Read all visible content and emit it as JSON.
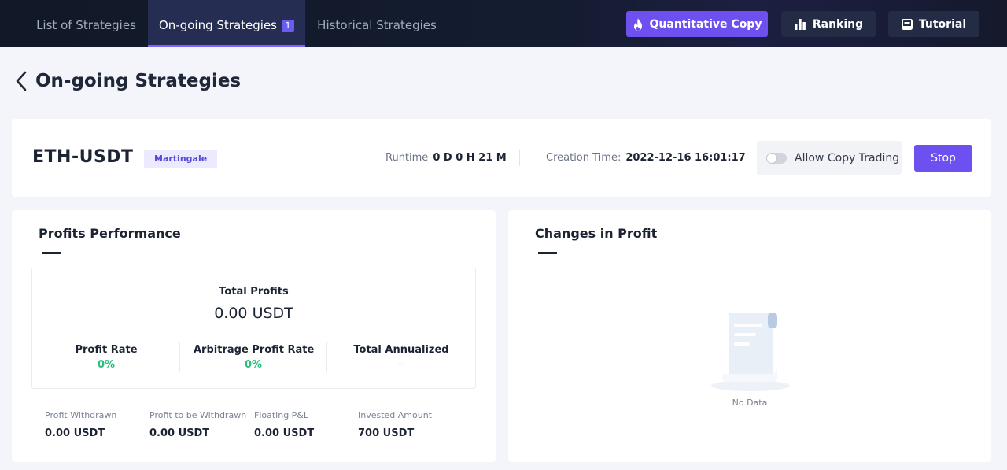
{
  "nav": {
    "tabs": [
      {
        "label": "List of Strategies"
      },
      {
        "label": "On-going Strategies",
        "badge": "1"
      },
      {
        "label": "Historical Strategies"
      }
    ],
    "buttons": {
      "quant_copy": "Quantitative Copy",
      "ranking": "Ranking",
      "tutorial": "Tutorial"
    },
    "colors": {
      "accent": "#7b61ff",
      "quant_button": "#6e4ff0",
      "dark_button": "#232b45"
    }
  },
  "page": {
    "title": "On-going Strategies",
    "back_icon": "chevron-left-icon"
  },
  "strategy": {
    "pair": "ETH-USDT",
    "type_tag": "Martingale",
    "runtime_label": "Runtime",
    "runtime_value": "0 D 0 H 21 M",
    "creation_label": "Creation Time:",
    "creation_value": "2022-12-16 16:01:17",
    "allow_copy_label": "Allow Copy Trading",
    "allow_copy_on": false,
    "stop_label": "Stop"
  },
  "profits": {
    "title": "Profits Performance",
    "total_label": "Total Profits",
    "total_value": "0.00 USDT",
    "stats": [
      {
        "label": "Profit Rate",
        "value": "0%"
      },
      {
        "label": "Arbitrage Profit Rate",
        "value": "0%"
      },
      {
        "label": "Total Annualized",
        "value": "--"
      }
    ],
    "bottom": [
      {
        "label": "Profit Withdrawn",
        "value": "0.00 USDT"
      },
      {
        "label": "Profit to be Withdrawn",
        "value": "0.00 USDT"
      },
      {
        "label": "Floating P&L",
        "value": "0.00 USDT"
      },
      {
        "label": "Invested Amount",
        "value": "700 USDT"
      }
    ],
    "colors": {
      "positive": "#2dbf7f"
    }
  },
  "changes": {
    "title": "Changes in Profit",
    "empty_text": "No Data",
    "empty_icon": "document-scroll-icon"
  }
}
